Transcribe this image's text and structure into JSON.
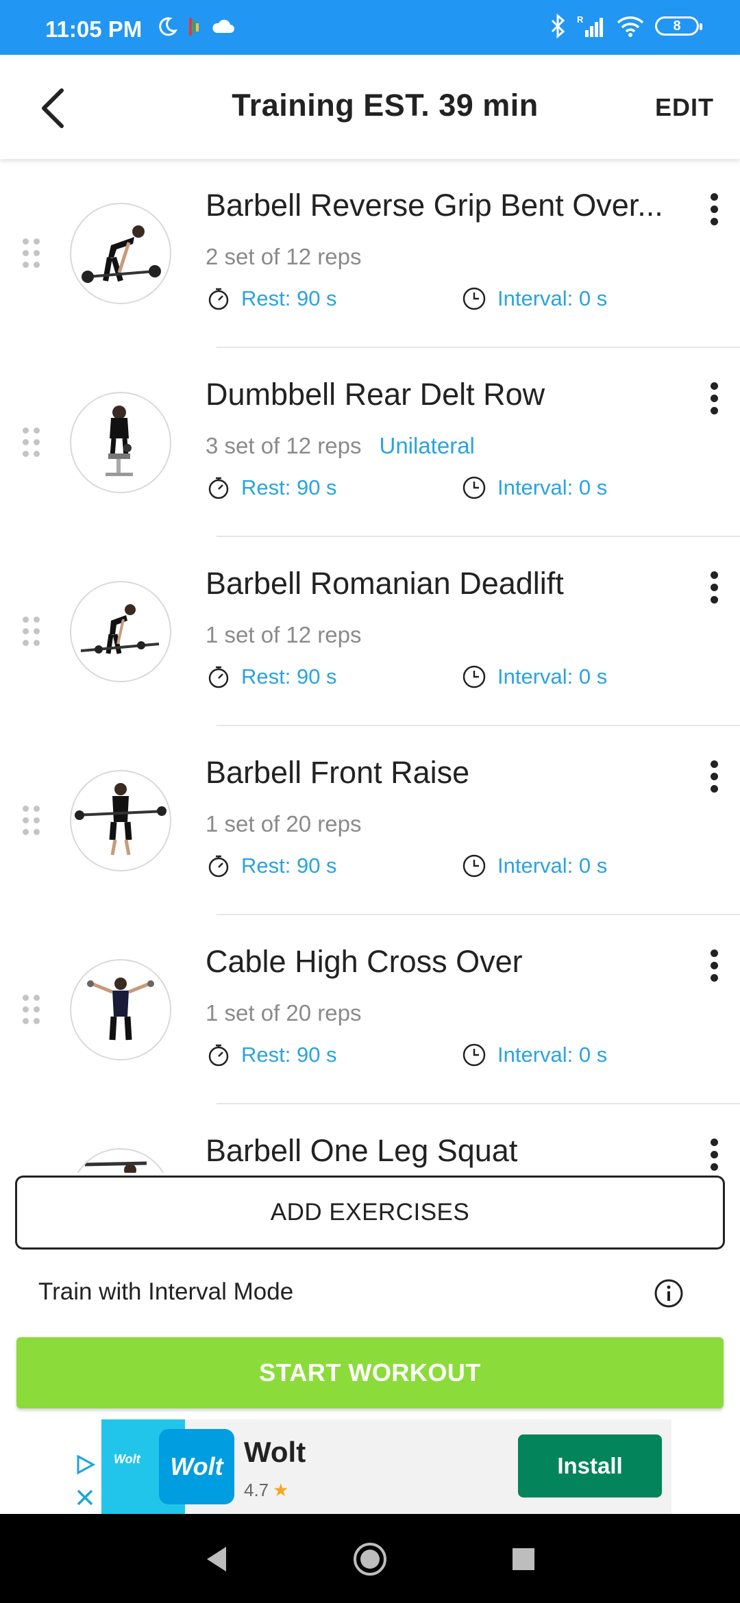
{
  "status_bar": {
    "time": "11:05 PM",
    "battery": "8",
    "icons": [
      "moon-icon",
      "app-notification-icon",
      "cloud-icon",
      "bluetooth-icon",
      "signal-icon",
      "wifi-icon",
      "battery-icon"
    ]
  },
  "header": {
    "title": "Training EST. 39 min",
    "edit_label": "EDIT"
  },
  "exercises": [
    {
      "name": "Barbell Reverse Grip Bent Over...",
      "sets": "2 set of 12 reps",
      "tag": "",
      "rest": "Rest: 90 s",
      "interval": "Interval: 0 s"
    },
    {
      "name": "Dumbbell Rear Delt Row",
      "sets": "3 set of 12 reps",
      "tag": "Unilateral",
      "rest": "Rest: 90 s",
      "interval": "Interval: 0 s"
    },
    {
      "name": "Barbell Romanian Deadlift",
      "sets": "1 set of 12 reps",
      "tag": "",
      "rest": "Rest: 90 s",
      "interval": "Interval: 0 s"
    },
    {
      "name": "Barbell Front Raise",
      "sets": "1 set of 20 reps",
      "tag": "",
      "rest": "Rest: 90 s",
      "interval": "Interval: 0 s"
    },
    {
      "name": "Cable High Cross Over",
      "sets": "1 set of 20 reps",
      "tag": "",
      "rest": "Rest: 90 s",
      "interval": "Interval: 0 s"
    },
    {
      "name": "Barbell One Leg Squat",
      "sets": "",
      "tag": "",
      "rest": "",
      "interval": ""
    }
  ],
  "add_exercises_label": "ADD EXERCISES",
  "interval_mode_label": "Train with Interval Mode",
  "start_workout_label": "START WORKOUT",
  "ad": {
    "thumb_text": "Wolt",
    "logo_text": "Wolt",
    "name": "Wolt",
    "rating": "4.7",
    "install_label": "Install"
  },
  "colors": {
    "status_bar": "#2196f3",
    "accent_blue": "#29a3e0",
    "start_green": "#8bdc3a",
    "install_green": "#04845a"
  }
}
